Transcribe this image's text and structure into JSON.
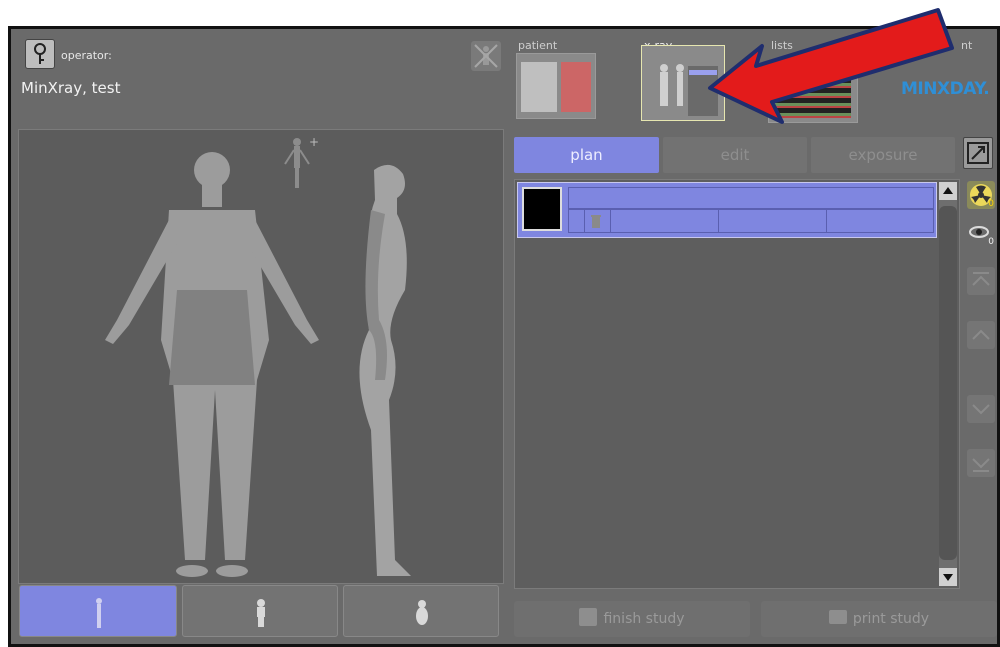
{
  "header": {
    "operator_label": "operator:",
    "operator_name": "MinXray,  test",
    "brand": "MINXDAY."
  },
  "thumbnails": [
    {
      "label": "patient"
    },
    {
      "label": "x-ray"
    },
    {
      "label": "lists"
    },
    {
      "label": "nt"
    }
  ],
  "tabs": [
    {
      "label": "plan",
      "active": true
    },
    {
      "label": "edit",
      "active": false
    },
    {
      "label": "exposure",
      "active": false
    }
  ],
  "counters": {
    "radiation": "0",
    "view": "0"
  },
  "buttons": {
    "finish_label": "finish study",
    "print_label": "print study"
  },
  "colors": {
    "accent": "#7f86e0",
    "background": "#6a6a6a",
    "arrow": "#e31b1b",
    "logo": "#2f8fd6"
  },
  "icons": {
    "operator": "key-icon",
    "logout": "person-crossed-icon",
    "fullscreen": "expand-icon",
    "radiation": "radiation-icon",
    "view": "eye-icon"
  }
}
